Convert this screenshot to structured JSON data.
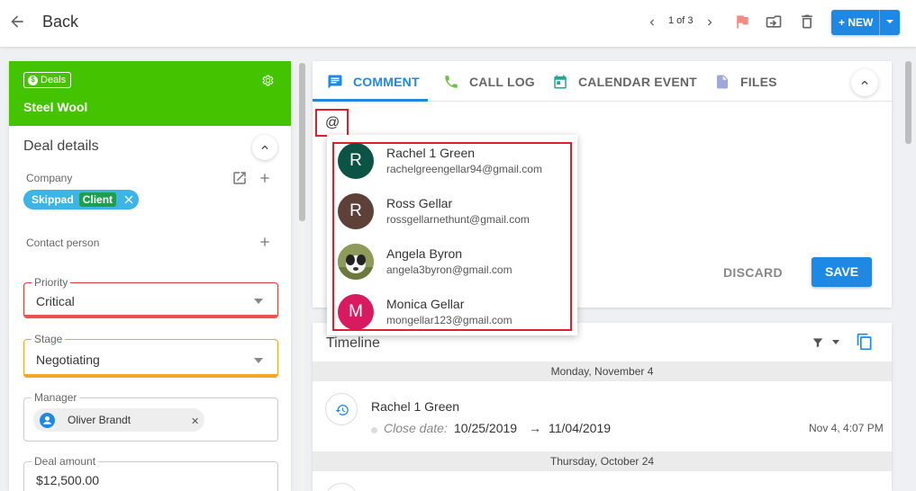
{
  "topbar": {
    "back_label": "Back",
    "pager_text": "1 of 3",
    "new_button_label": "+ NEW"
  },
  "deal": {
    "badge_label": "Deals",
    "name": "Steel Wool",
    "header_color": "#44c300",
    "section_title": "Deal details",
    "company_label": "Company",
    "company_name": "Skippad",
    "company_tag": "Client",
    "contact_label": "Contact person",
    "priority_label": "Priority",
    "priority_value": "Critical",
    "stage_label": "Stage",
    "stage_value": "Negotiating",
    "manager_label": "Manager",
    "manager_name": "Oliver Brandt",
    "amount_label": "Deal amount",
    "amount_value": "$12,500.00"
  },
  "composer": {
    "tabs": [
      {
        "label": "COMMENT",
        "icon": "comment-icon",
        "active": true
      },
      {
        "label": "CALL LOG",
        "icon": "phone-icon",
        "active": false
      },
      {
        "label": "CALENDAR EVENT",
        "icon": "calendar-icon",
        "active": false
      },
      {
        "label": "FILES",
        "icon": "file-icon",
        "active": false
      }
    ],
    "input_value": "@",
    "discard_label": "DISCARD",
    "save_label": "SAVE",
    "accent_color": "#1e88e5"
  },
  "mentions": [
    {
      "initial": "R",
      "name": "Rachel 1 Green",
      "email": "rachelgreengellar94@gmail.com",
      "color": "#0b5345"
    },
    {
      "initial": "R",
      "name": "Ross Gellar",
      "email": "rossgellarnethunt@gmail.com",
      "color": "#5d4037"
    },
    {
      "initial": "",
      "name": "Angela Byron",
      "email": "angela3byron@gmail.com",
      "color": "#7a8b50"
    },
    {
      "initial": "M",
      "name": "Monica Gellar",
      "email": "mongellar123@gmail.com",
      "color": "#d81b60"
    }
  ],
  "timeline": {
    "title": "Timeline",
    "date_header_1": "Monday, November 4",
    "event_title": "Rachel 1 Green",
    "event_label": "Close date:",
    "event_from": "10/25/2019",
    "event_arrow": "→",
    "event_to": "11/04/2019",
    "event_time": "Nov 4, 4:07 PM",
    "date_header_2": "Thursday, October 24"
  }
}
